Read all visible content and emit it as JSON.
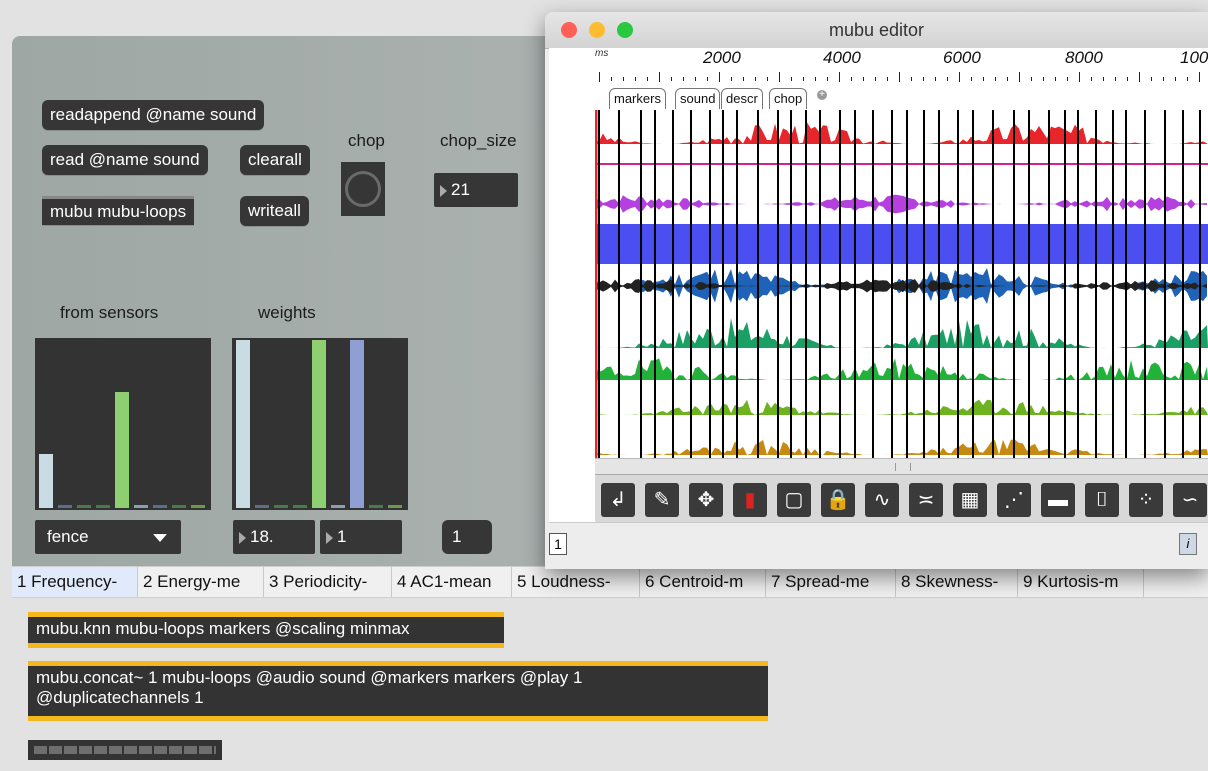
{
  "patcher": {
    "messages": {
      "readappend": "readappend @name sound",
      "read": "read @name sound",
      "clearall": "clearall",
      "mubu_loops": "mubu mubu-loops",
      "writeall": "writeall"
    },
    "labels": {
      "chop": "chop",
      "chop_size": "chop_size",
      "from_sensors": "from sensors",
      "weights": "weights"
    },
    "numbers": {
      "chop_size": "21",
      "weight_a": "18.",
      "weight_b": "1",
      "index_box": "1"
    },
    "dropdown": {
      "selected": "fence"
    },
    "from_sensors_bars": [
      0.32,
      0.01,
      0.01,
      0.01,
      0.69,
      0.01,
      0.01,
      0.01,
      0.01
    ],
    "weights_bars": [
      1.0,
      0.01,
      0.01,
      0.01,
      1.0,
      0.01,
      1.0,
      0.01,
      0.01
    ],
    "colors": {
      "bar_light": "#c9dce4",
      "bar_green": "#8ed071",
      "bar_blue": "#8f9fd4",
      "accent_orange": "#f5b71e"
    }
  },
  "tabs": [
    {
      "label": "1 Frequency-"
    },
    {
      "label": "2 Energy-me"
    },
    {
      "label": "3 Periodicity-"
    },
    {
      "label": "4 AC1-mean"
    },
    {
      "label": "5 Loudness-"
    },
    {
      "label": "6 Centroid-m"
    },
    {
      "label": "7 Spread-me"
    },
    {
      "label": "8 Skewness-"
    },
    {
      "label": "9 Kurtosis-m"
    }
  ],
  "objects": {
    "knn": "mubu.knn mubu-loops markers @scaling minmax",
    "concat_line1": "mubu.concat~ 1 mubu-loops @audio sound @markers markers @play 1",
    "concat_line2": "@duplicatechannels 1"
  },
  "editor": {
    "title": "mubu editor",
    "ruler_unit": "ms",
    "ruler_labels": [
      "2000",
      "4000",
      "6000",
      "8000",
      "100"
    ],
    "tabs": [
      "markers",
      "sound",
      "descr",
      "chop"
    ],
    "add_tab_icon": "plus-circle-icon",
    "view_number": "1",
    "tools": [
      "select-arrow-icon",
      "pencil-icon",
      "move-icon",
      "cursor-bar-icon",
      "rectangle-icon",
      "lock-icon",
      "line-icon",
      "connect-icon",
      "grid-icon",
      "scatter-icon",
      "matrix-icon",
      "bracket-icon",
      "points-icon",
      "curve-icon"
    ],
    "track_colors": [
      "#e8252b",
      "#d9218a",
      "#b63fe0",
      "#4b4ff2",
      "#1f63b8",
      "#1aa065",
      "#22b23a",
      "#6db21f",
      "#c78a10"
    ]
  }
}
